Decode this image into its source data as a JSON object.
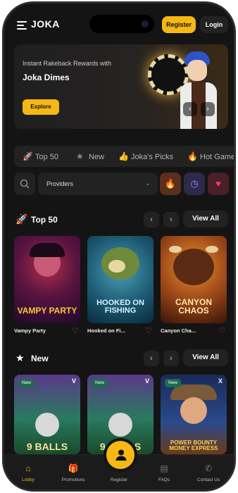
{
  "header": {
    "logo": "JOKA",
    "register": "Register",
    "login": "Login"
  },
  "hero": {
    "subtitle": "Instant Rakeback Rewards with",
    "title": "Joka Dimes",
    "cta": "Explore",
    "prev": "‹",
    "next": "›"
  },
  "categories": [
    {
      "icon": "rocket-icon",
      "label": "Top 50"
    },
    {
      "icon": "star-icon",
      "label": "New"
    },
    {
      "icon": "thumbs-up-icon",
      "label": "Joka's Picks"
    },
    {
      "icon": "fire-icon",
      "label": "Hot Games"
    }
  ],
  "filters": {
    "providers_placeholder": "Providers",
    "chevron": "⌄"
  },
  "sections": {
    "top50": {
      "title": "Top 50",
      "view_all": "View All",
      "prev": "‹",
      "next": "›"
    },
    "new": {
      "title": "New",
      "view_all": "View All",
      "prev": "‹",
      "next": "›"
    }
  },
  "top50_games": [
    {
      "name": "Vampy Party",
      "art_text": "VAMPY PARTY"
    },
    {
      "name": "Hooked on Fi...",
      "art_text": "HOOKED ON FISHING"
    },
    {
      "name": "Canyon Cha...",
      "art_text": "CANYON CHAOS"
    }
  ],
  "new_games": [
    {
      "badge": "New",
      "corner": "V",
      "art_text": "9 BALLS"
    },
    {
      "badge": "New",
      "corner": "V",
      "art_text": "9 BALLS"
    },
    {
      "badge": "New",
      "corner": "X",
      "art_text": "POWER BOUNTY MONEY EXPRESS"
    }
  ],
  "bottom_nav": [
    {
      "label": "Lobby",
      "icon": "home-icon",
      "active": true
    },
    {
      "label": "Promotions",
      "icon": "gift-icon"
    },
    {
      "label": "Register",
      "icon": "user-icon"
    },
    {
      "label": "FAQs",
      "icon": "book-icon"
    },
    {
      "label": "Contact Us",
      "icon": "phone-icon"
    }
  ],
  "colors": {
    "accent": "#f5b814",
    "background": "#141414",
    "surface": "#222222",
    "heart": "#e6446a"
  }
}
